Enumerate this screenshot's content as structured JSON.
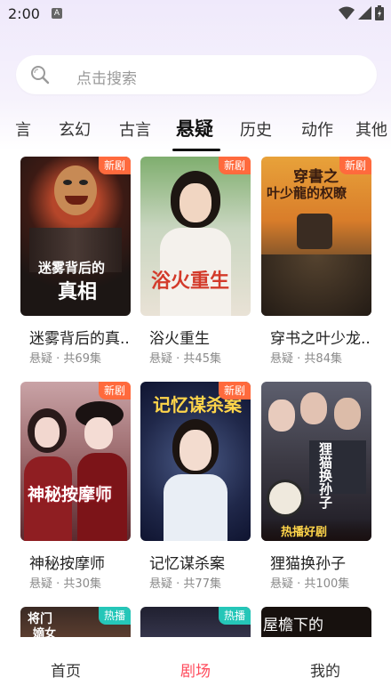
{
  "status_bar": {
    "time": "2:00",
    "notification_letter": "A"
  },
  "search": {
    "placeholder": "点击搜索"
  },
  "tabs": [
    {
      "label": "言"
    },
    {
      "label": "玄幻"
    },
    {
      "label": "古言"
    },
    {
      "label": "悬疑",
      "active": true
    },
    {
      "label": "历史"
    },
    {
      "label": "动作"
    },
    {
      "label": "其他"
    }
  ],
  "badges": {
    "new": "新剧",
    "hot": "热播"
  },
  "dramas": [
    {
      "title": "迷雾背后的真..",
      "genre": "悬疑",
      "episodes": "共69集",
      "badge": "新剧",
      "cover_text": [
        "迷雾背后的",
        "真相"
      ]
    },
    {
      "title": "浴火重生",
      "genre": "悬疑",
      "episodes": "共45集",
      "badge": "新剧",
      "cover_text": [
        "浴火重生"
      ]
    },
    {
      "title": "穿书之叶少龙..",
      "genre": "悬疑",
      "episodes": "共84集",
      "badge": "新剧",
      "cover_text": [
        "穿書之",
        "叶少龍的权瞭"
      ]
    },
    {
      "title": "神秘按摩师",
      "genre": "悬疑",
      "episodes": "共30集",
      "badge": "新剧",
      "cover_text": [
        "神秘按摩师"
      ]
    },
    {
      "title": "记忆谋杀案",
      "genre": "悬疑",
      "episodes": "共77集",
      "badge": "新剧",
      "cover_text": [
        "记忆谋杀案"
      ]
    },
    {
      "title": "狸猫换孙子",
      "genre": "悬疑",
      "episodes": "共100集",
      "badge": "",
      "cover_text": [
        "狸猫换孙子",
        "热播好剧"
      ]
    },
    {
      "title": "",
      "genre": "",
      "episodes": "",
      "badge": "热播",
      "cover_text": [
        "将门",
        "嫡女"
      ]
    },
    {
      "title": "",
      "genre": "",
      "episodes": "",
      "badge": "热播",
      "cover_text": []
    },
    {
      "title": "",
      "genre": "",
      "episodes": "",
      "badge": "",
      "cover_text": [
        "屋檐下的"
      ]
    }
  ],
  "bottom_nav": [
    {
      "label": "首页"
    },
    {
      "label": "剧场",
      "active": true
    },
    {
      "label": "我的"
    }
  ],
  "colors": {
    "accent": "#ff4b5c",
    "badge_new": "#ff6a3d",
    "badge_hot": "#25c6b8"
  }
}
